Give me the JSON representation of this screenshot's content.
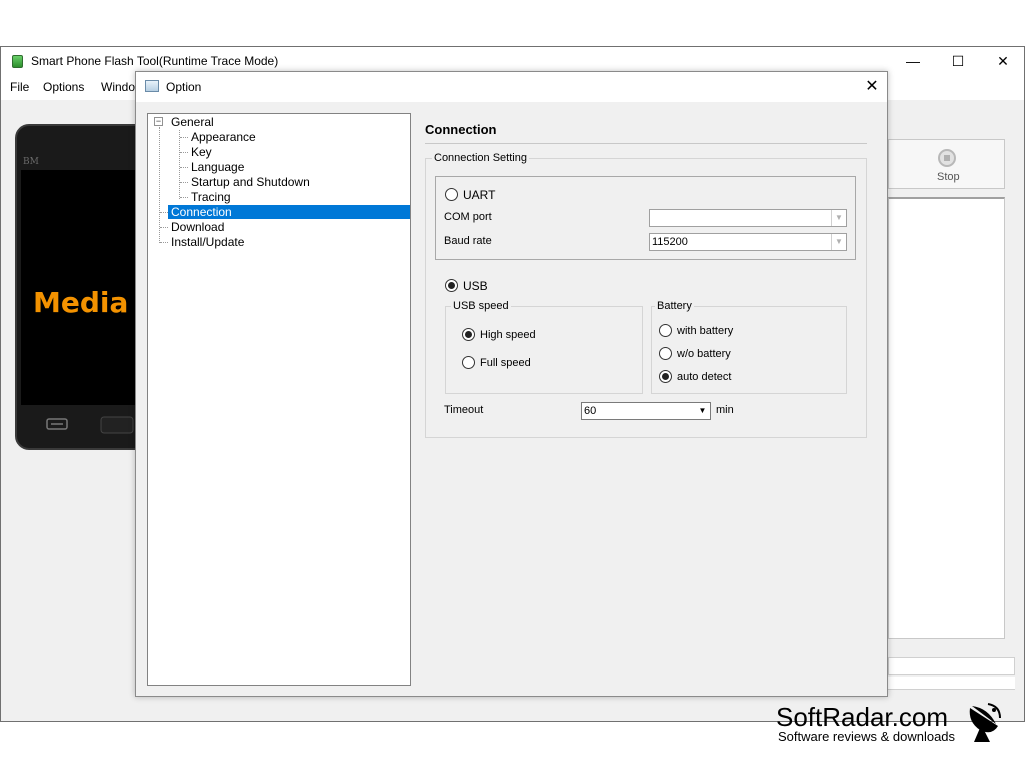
{
  "main_window": {
    "title": "Smart Phone Flash Tool(Runtime Trace Mode)",
    "controls": {
      "minimize": "—",
      "maximize": "☐",
      "close": "✕"
    },
    "menu": [
      "File",
      "Options",
      "Windo"
    ],
    "phone": {
      "brand": "BM",
      "screen_text": "Media"
    },
    "stop_label": "Stop"
  },
  "dialog": {
    "title": "Option",
    "close": "✕",
    "tree": {
      "root": "General",
      "children": [
        "Appearance",
        "Key",
        "Language",
        "Startup and Shutdown",
        "Tracing"
      ],
      "items": [
        "Connection",
        "Download",
        "Install/Update"
      ],
      "selected": "Connection"
    },
    "content": {
      "title": "Connection",
      "group_title": "Connection Setting",
      "uart": {
        "label": "UART",
        "selected": false,
        "com_port_label": "COM port",
        "com_port_value": "",
        "baud_rate_label": "Baud rate",
        "baud_rate_value": "115200"
      },
      "usb": {
        "label": "USB",
        "selected": true,
        "speed_group": "USB speed",
        "speed_options": [
          "High speed",
          "Full speed"
        ],
        "speed_selected": "High speed",
        "battery_group": "Battery",
        "battery_options": [
          "with battery",
          "w/o battery",
          "auto detect"
        ],
        "battery_selected": "auto detect"
      },
      "timeout_label": "Timeout",
      "timeout_value": "60",
      "timeout_unit": "min"
    }
  },
  "watermark": {
    "title": "SoftRadar.com",
    "subtitle": "Software reviews & downloads"
  }
}
